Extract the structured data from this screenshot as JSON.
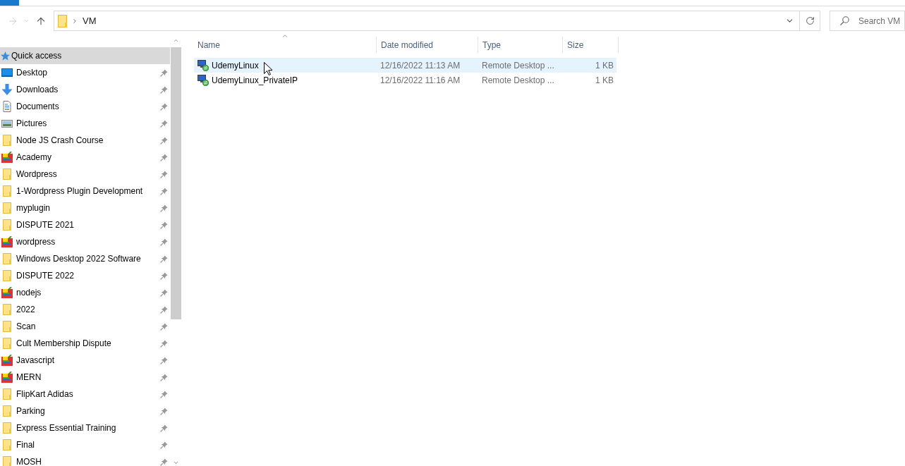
{
  "toolbar": {
    "nav_buttons": [
      {
        "kind": "forward",
        "disabled": true
      },
      {
        "kind": "recent",
        "disabled": true
      },
      {
        "kind": "up",
        "disabled": false
      }
    ]
  },
  "address_bar": {
    "path": [
      "VM"
    ]
  },
  "search": {
    "placeholder": "Search VM"
  },
  "sidebar": {
    "items": [
      {
        "label": "Quick access",
        "kind": "quick-access",
        "selected": true,
        "children": [
          {
            "label": "Desktop",
            "kind": "desktop",
            "pinned": true,
            "selected": false
          },
          {
            "label": "Downloads",
            "kind": "downloads",
            "pinned": true,
            "selected": false
          },
          {
            "label": "Documents",
            "kind": "documents",
            "pinned": true,
            "selected": false
          },
          {
            "label": "Pictures",
            "kind": "pictures",
            "pinned": true,
            "selected": false
          },
          {
            "label": "Node JS Crash Course",
            "kind": "folder",
            "pinned": true,
            "selected": false
          },
          {
            "label": "Academy",
            "kind": "project",
            "pinned": true,
            "selected": false
          },
          {
            "label": "Wordpress",
            "kind": "folder",
            "pinned": true,
            "selected": false
          },
          {
            "label": "1-Wordpress Plugin Development",
            "kind": "folder",
            "pinned": true,
            "selected": false
          },
          {
            "label": "myplugin",
            "kind": "folder",
            "pinned": true,
            "selected": false
          },
          {
            "label": "DISPUTE 2021",
            "kind": "folder",
            "pinned": true,
            "selected": false
          },
          {
            "label": "wordpress",
            "kind": "project",
            "pinned": true,
            "selected": false
          },
          {
            "label": "Windows Desktop 2022 Software",
            "kind": "folder",
            "pinned": true,
            "selected": false
          },
          {
            "label": "DISPUTE 2022",
            "kind": "folder",
            "pinned": true,
            "selected": false
          },
          {
            "label": "nodejs",
            "kind": "project",
            "pinned": true,
            "selected": false
          },
          {
            "label": "2022",
            "kind": "folder",
            "pinned": true,
            "selected": false
          },
          {
            "label": "Scan",
            "kind": "folder",
            "pinned": true,
            "selected": false
          },
          {
            "label": "Cult Membership Dispute",
            "kind": "folder",
            "pinned": true,
            "selected": false
          },
          {
            "label": "Javascript",
            "kind": "project",
            "pinned": true,
            "selected": false
          },
          {
            "label": "MERN",
            "kind": "project",
            "pinned": true,
            "selected": false
          },
          {
            "label": "FlipKart Adidas",
            "kind": "folder",
            "pinned": true,
            "selected": false
          },
          {
            "label": "Parking",
            "kind": "folder",
            "pinned": true,
            "selected": false
          },
          {
            "label": "Express Essential Training",
            "kind": "folder",
            "pinned": true,
            "selected": false
          },
          {
            "label": "Final",
            "kind": "folder",
            "pinned": true,
            "selected": false
          },
          {
            "label": "MOSH",
            "kind": "folder",
            "pinned": true,
            "selected": false
          }
        ]
      }
    ]
  },
  "file_list": {
    "columns": [
      {
        "label": "Name",
        "sorted": true
      },
      {
        "label": "Date modified",
        "sorted": false
      },
      {
        "label": "Type",
        "sorted": false
      },
      {
        "label": "Size",
        "sorted": false
      }
    ],
    "rows": [
      {
        "kind": "rdp",
        "name": "UdemyLinux",
        "date_modified": "12/16/2022 11:13 AM",
        "type": "Remote Desktop ...",
        "size": "1 KB",
        "selected": true
      },
      {
        "kind": "rdp",
        "name": "UdemyLinux_PrivateIP",
        "date_modified": "12/16/2022 11:16 AM",
        "type": "Remote Desktop ...",
        "size": "1 KB",
        "selected": false
      }
    ]
  }
}
